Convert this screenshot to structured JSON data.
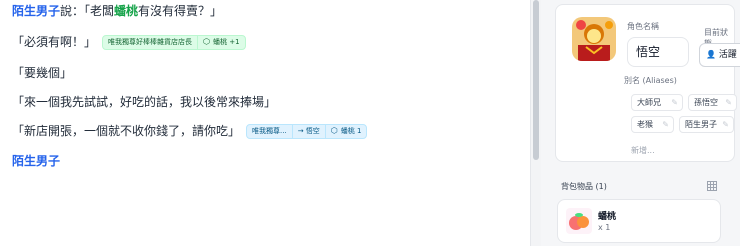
{
  "story": {
    "line1": {
      "speaker": "陌生男子",
      "said": "說：「老闆",
      "item": "蟠桃",
      "rest": "有沒有得賣？」"
    },
    "line2": {
      "text": "「必須有啊！」",
      "pill": {
        "speaker": "唯我獨尊好棒棒雜貨店店長",
        "item": "蟠桃 +1"
      }
    },
    "line3": {
      "text": "「要幾個」"
    },
    "line4": {
      "text": "「來一個我先試試，好吃的話，我以後常來捧場」"
    },
    "line5": {
      "text": "「新店開張，一個就不收你錢了，請你吃」",
      "pill": {
        "from": "唯我獨尊...",
        "to": "→ 悟空",
        "item": "蟠桃 1"
      }
    },
    "line6": {
      "speaker": "陌生男子"
    }
  },
  "panel": {
    "role_name_label": "角色名稱",
    "role_name": "悟空",
    "status_label": "目前狀態",
    "status_value": "活躍",
    "aliases_label": "別名 (Aliases)",
    "aliases": [
      "大師兄",
      "孫悟空",
      "老猴",
      "陌生男子"
    ],
    "new_alias_placeholder": "新增...",
    "bag_label": "背包物品 (1)",
    "bag_items": [
      {
        "name": "蟠桃",
        "qty": "x 1"
      }
    ]
  },
  "colors": {
    "speaker": "#2563eb",
    "item": "#16a34a",
    "panel_bg": "#f5f6f8"
  },
  "icons": [
    "cube-icon",
    "arrow-right-icon",
    "user-icon",
    "pencil-icon",
    "grid-icon",
    "peach-image",
    "avatar-image"
  ]
}
